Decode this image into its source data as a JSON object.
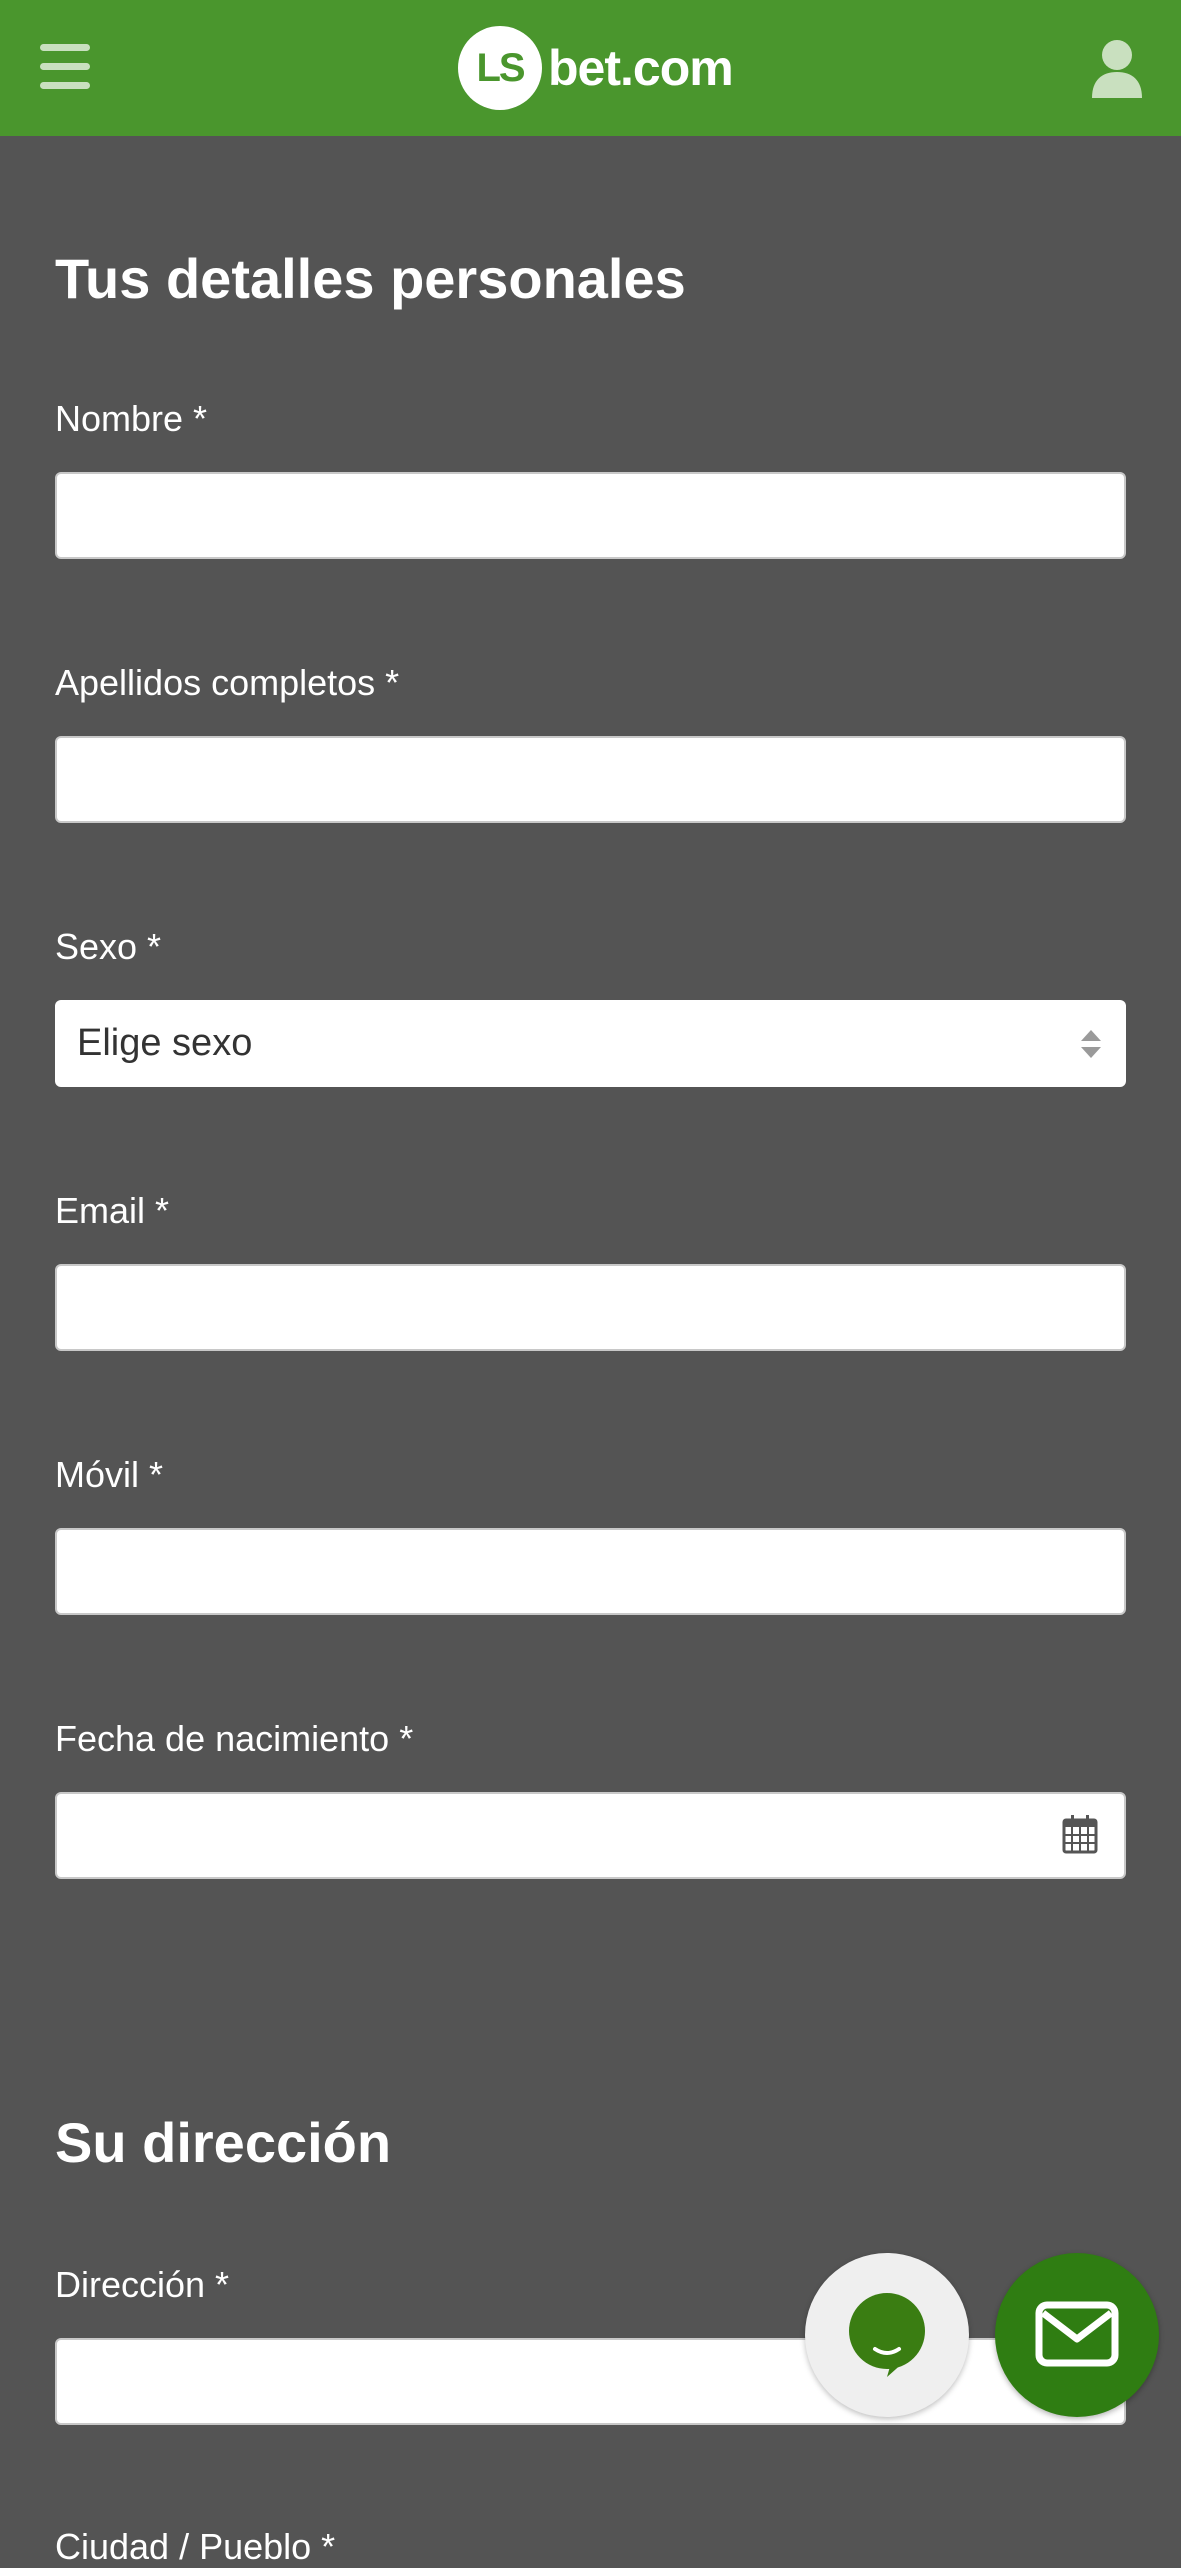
{
  "header": {
    "menu_icon": "hamburger-menu-icon",
    "logo_badge": "LS",
    "logo_text": "bet.com",
    "user_icon": "user-icon",
    "brand_color": "#4a962d"
  },
  "personal": {
    "title": "Tus detalles personales",
    "fields": {
      "first_name": {
        "label": "Nombre *",
        "value": ""
      },
      "last_name": {
        "label": "Apellidos completos *",
        "value": ""
      },
      "gender": {
        "label": "Sexo *",
        "selected": "Elige sexo"
      },
      "email": {
        "label": "Email *",
        "value": ""
      },
      "mobile": {
        "label": "Móvil *",
        "value": ""
      },
      "birthdate": {
        "label": "Fecha de nacimiento *",
        "value": ""
      }
    }
  },
  "address": {
    "title": "Su dirección",
    "fields": {
      "street": {
        "label": "Dirección *",
        "value": ""
      },
      "city": {
        "label": "Ciudad / Pueblo *"
      }
    }
  },
  "floating": {
    "chat_icon": "chat-bubble-icon",
    "mail_icon": "envelope-icon",
    "mail_color": "#2f7d12"
  }
}
